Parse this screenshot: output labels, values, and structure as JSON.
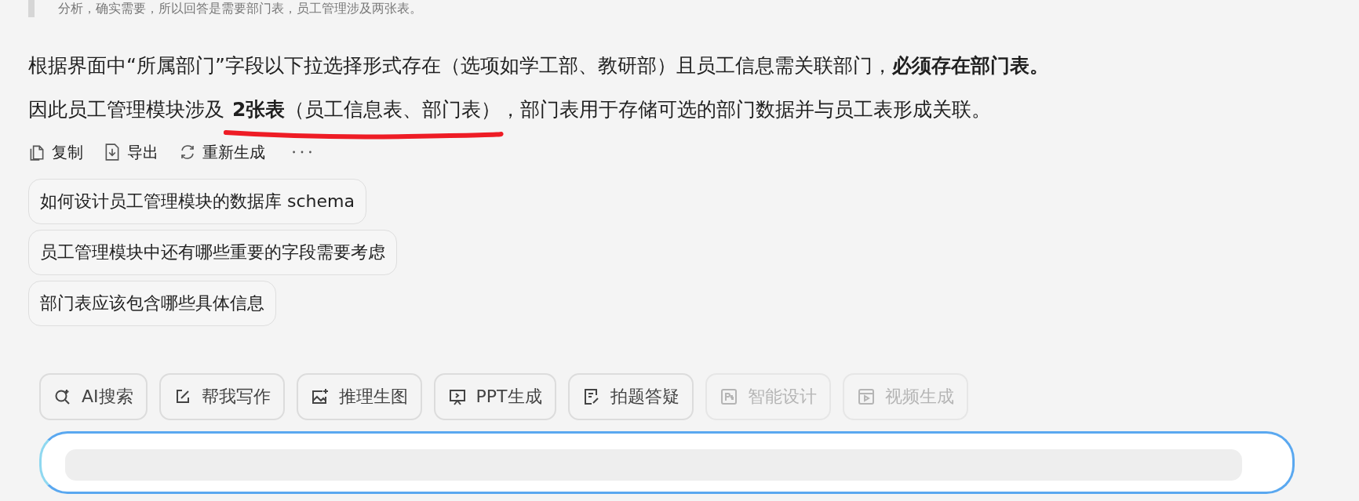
{
  "quote_tail": "分析，确实需要，所以回答是需要部门表，员工管理涉及两张表。",
  "answer": {
    "line_1": "根据界面中“所属部门”字段以下拉选择形式存在（选项如学工部、教研部）且员工信息需关联部门，**必须存在部门表。**",
    "line_2": {
      "before": "因此员工管理模块涉及",
      "highlight": "**2张表**（员工信息表、部门表）",
      "after": "，部门表用于存储可选的部门数据并与员工表形成关联。"
    }
  },
  "actions": [
    {
      "kind": "copy",
      "label": "复制"
    },
    {
      "kind": "export",
      "label": "导出"
    },
    {
      "kind": "regenerate",
      "label": "重新生成"
    },
    {
      "kind": "more"
    }
  ],
  "suggestions": [
    "如何设计员工管理模块的数据库 schema",
    "员工管理模块中还有哪些重要的字段需要考虑",
    "部门表应该包含哪些具体信息"
  ],
  "tools": [
    {
      "kind": "search",
      "label": "AI搜索",
      "disabled": false
    },
    {
      "kind": "write",
      "label": "帮我写作",
      "disabled": false
    },
    {
      "kind": "image",
      "label": "推理生图",
      "disabled": false
    },
    {
      "kind": "ppt",
      "label": "PPT生成",
      "disabled": false
    },
    {
      "kind": "homework",
      "label": "拍题答疑",
      "disabled": false
    },
    {
      "kind": "design",
      "label": "智能设计",
      "disabled": true
    },
    {
      "kind": "video",
      "label": "视频生成",
      "disabled": true
    }
  ]
}
